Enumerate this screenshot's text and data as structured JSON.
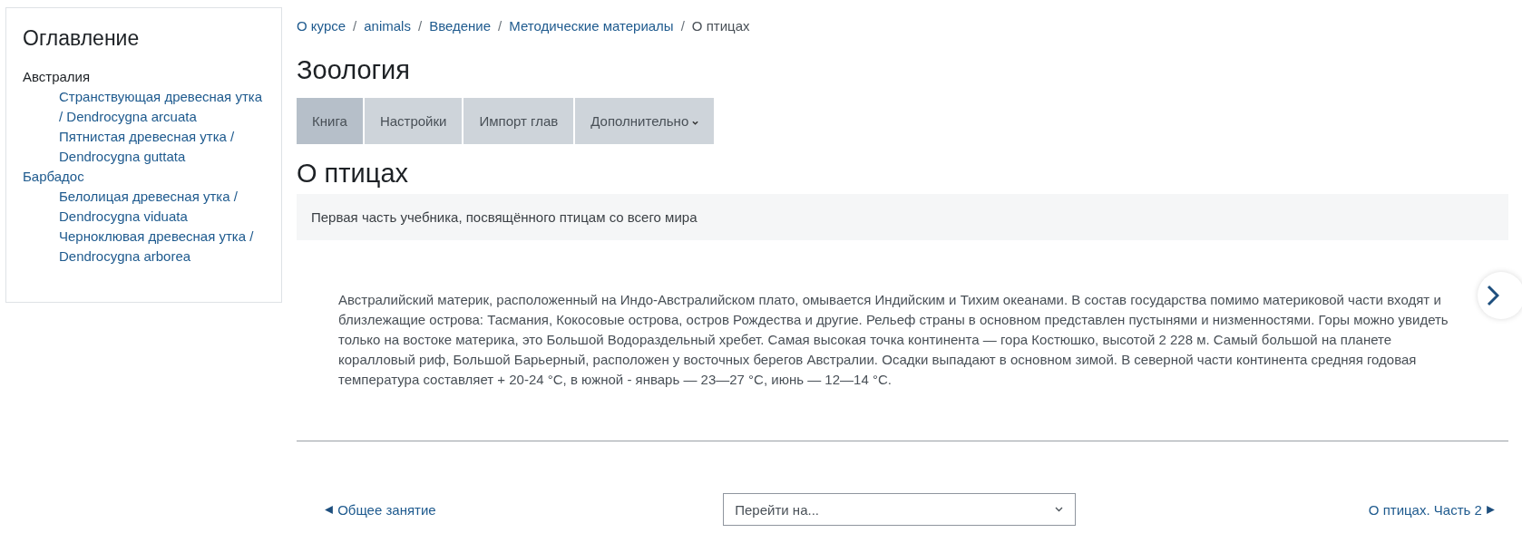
{
  "sidebar": {
    "title": "Оглавление",
    "items": [
      {
        "label": "Австралия",
        "selected": true,
        "children": [
          {
            "label": "Странствующая древесная утка / Dendrocygna arcuata",
            "selected": false
          },
          {
            "label": "Пятнистая древесная утка / Dendrocygna guttata",
            "selected": false
          }
        ]
      },
      {
        "label": "Барбадос",
        "selected": false,
        "children": [
          {
            "label": "Белолицая древесная утка / Dendrocygna viduata",
            "selected": false
          },
          {
            "label": "Черноклювая древесная утка / Dendrocygna arborea",
            "selected": false
          }
        ]
      }
    ]
  },
  "breadcrumb": [
    {
      "label": "О курсе",
      "current": false
    },
    {
      "label": "animals",
      "current": false
    },
    {
      "label": "Введение",
      "current": false
    },
    {
      "label": "Методические материалы",
      "current": false
    },
    {
      "label": "О птицах",
      "current": true
    }
  ],
  "breadcrumb_separator": "/",
  "title": "Зоология",
  "tabs": [
    {
      "label": "Книга",
      "selected": true,
      "dropdown": false
    },
    {
      "label": "Настройки",
      "selected": false,
      "dropdown": false
    },
    {
      "label": "Импорт глав",
      "selected": false,
      "dropdown": false
    },
    {
      "label": "Дополнительно",
      "selected": false,
      "dropdown": true
    }
  ],
  "chapter": {
    "title": "О птицах",
    "summary": "Первая часть учебника, посвящённого птицам со всего мира",
    "body": "Австралийский материк, расположенный на Индо-Австралийском плато, омывается Индийским и Тихим океанами. В состав государства помимо материковой части входят и близлежащие острова: Тасмания, Кокосовые острова, остров Рождества и другие. Рельеф страны в основном представлен пустынями и низменностями. Горы можно увидеть только на востоке материка, это Большой Водораздельный хребет. Самая высокая точка континента — гора Костюшко, высотой 2 228 м. Самый большой на планете коралловый риф, Большой Барьерный, расположен у восточных берегов Австралии. Осадки выпадают в основном зимой. В северной части континента средняя годовая температура составляет + 20-24 °С, в южной - январь — 23—27 °С, июнь — 12—14 °С."
  },
  "navigation": {
    "previous": "Общее занятие",
    "jump": {
      "placeholder": "Перейти на..."
    },
    "next": "О птицах. Часть 2"
  }
}
